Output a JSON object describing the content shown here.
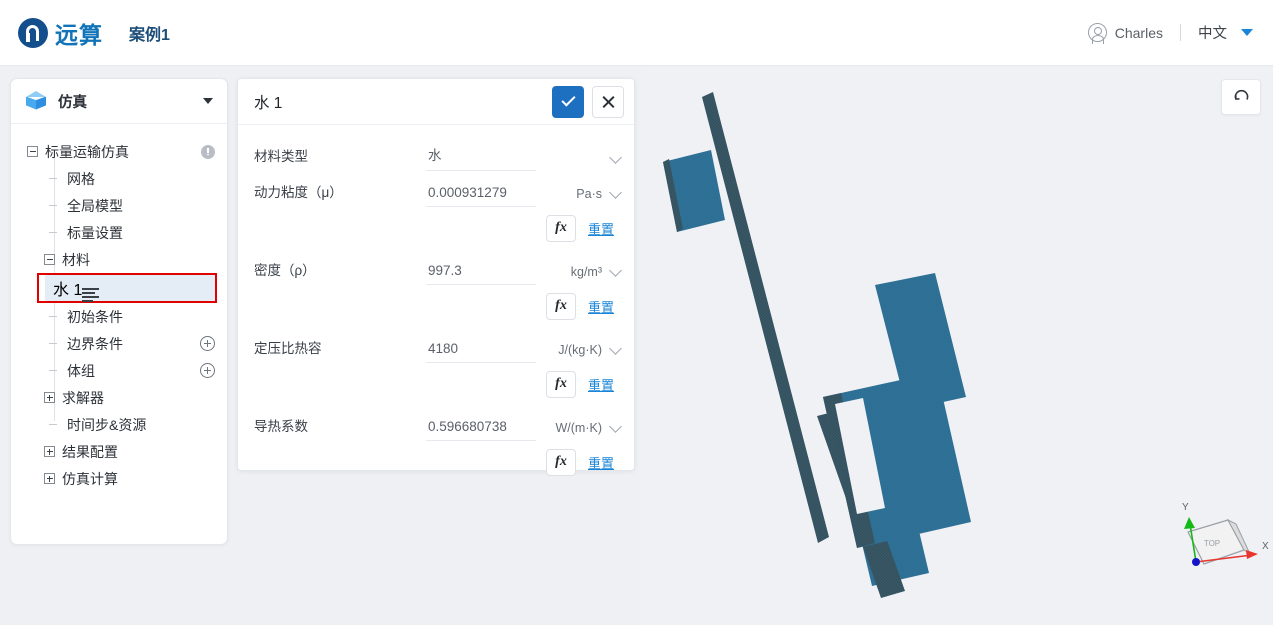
{
  "header": {
    "logo_text": "远算",
    "logo_icon": "company-logo-icon",
    "case_title": "案例1",
    "user_icon": "user-avatar-icon",
    "user_name": "Charles",
    "language": "中文",
    "language_caret_icon": "caret-down-icon"
  },
  "sidebar": {
    "panel_icon": "cube-icon",
    "panel_title": "仿真",
    "collapse_icon": "caret-down-icon",
    "tree": [
      {
        "label": "标量运输仿真",
        "level": 0,
        "toggle": "minus",
        "right_icon": "warning-circle-icon"
      },
      {
        "label": "网格",
        "level": 1,
        "toggle": "none",
        "right_icon": ""
      },
      {
        "label": "全局模型",
        "level": 1,
        "toggle": "none",
        "right_icon": ""
      },
      {
        "label": "标量设置",
        "level": 1,
        "toggle": "none",
        "right_icon": ""
      },
      {
        "label": "材料",
        "level": 1,
        "toggle": "minus",
        "right_icon": ""
      },
      {
        "label": "水 1",
        "level": 2,
        "toggle": "none",
        "right_icon": "list-lines-icon",
        "selected": true,
        "highlighted": true
      },
      {
        "label": "初始条件",
        "level": 1,
        "toggle": "none",
        "right_icon": ""
      },
      {
        "label": "边界条件",
        "level": 1,
        "toggle": "none",
        "right_icon": "plus-circle-icon"
      },
      {
        "label": "体组",
        "level": 1,
        "toggle": "none",
        "right_icon": "plus-circle-icon"
      },
      {
        "label": "求解器",
        "level": 1,
        "toggle": "plus",
        "right_icon": ""
      },
      {
        "label": "时间步&资源",
        "level": 1,
        "toggle": "none",
        "right_icon": ""
      },
      {
        "label": "结果配置",
        "level": 1,
        "toggle": "plus",
        "right_icon": ""
      },
      {
        "label": "仿真计算",
        "level": 1,
        "toggle": "plus",
        "right_icon": ""
      }
    ]
  },
  "properties": {
    "title": "水 1",
    "confirm_icon": "check-icon",
    "cancel_icon": "close-icon",
    "fx_label": "fx",
    "reset_label": "重置",
    "rows": [
      {
        "label": "材料类型",
        "value": "水",
        "unit": "",
        "has_fx": false
      },
      {
        "label": "动力粘度（μ）",
        "value": "0.000931279",
        "unit": "Pa·s",
        "has_fx": true
      },
      {
        "label": "密度（ρ）",
        "value": "997.3",
        "unit": "kg/m³",
        "has_fx": true
      },
      {
        "label": "定压比热容",
        "value": "4180",
        "unit": "J/(kg·K)",
        "has_fx": true
      },
      {
        "label": "导热系数",
        "value": "0.596680738",
        "unit": "W/(m·K)",
        "has_fx": true
      }
    ]
  },
  "viewport": {
    "reset_view_icon": "rotate-reset-icon",
    "gizmo": {
      "face_label": "TOP",
      "x_label": "X",
      "y_label": "Y",
      "x_color": "#e8352d",
      "y_color": "#14b914",
      "z_color": "#1414c8"
    },
    "mesh_color": "#2a7296",
    "background_color": "#f0f1f5"
  }
}
